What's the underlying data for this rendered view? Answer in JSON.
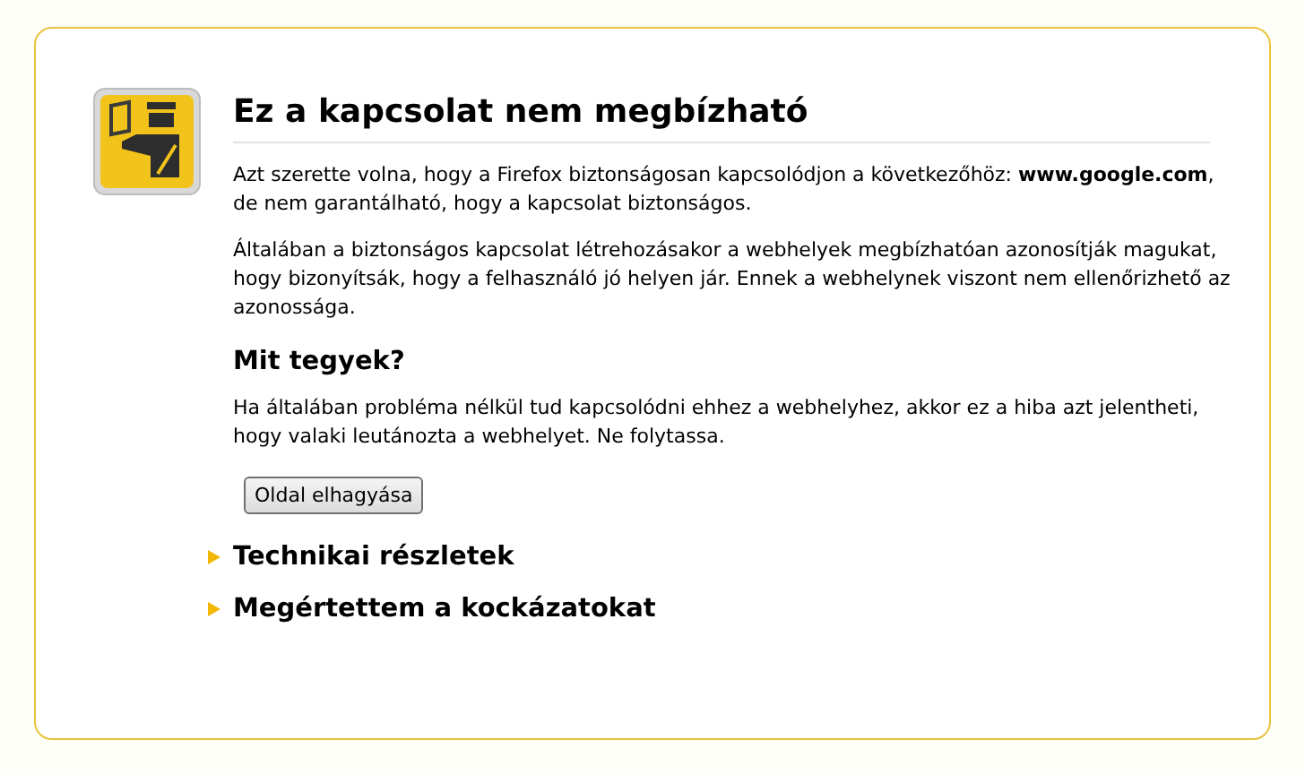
{
  "title": "Ez a kapcsolat nem megbízható",
  "intro": "Azt szerette volna, hogy a Firefox biztonságosan kapcsolódjon a következőhöz: **www.google.com**, de nem garantálható, hogy a kapcsolat biztonságos.",
  "explanation": "Általában a biztonságos kapcsolat létrehozásakor a webhelyek megbízhatóan azonosítják magukat, hogy bizonyítsák, hogy a felhasználó jó helyen jár. Ennek a webhelynek viszont nem ellenőrizhető az azonossága.",
  "what_to_do": {
    "heading": "Mit tegyek?",
    "text": "Ha általában probléma nélkül tud kapcsolódni ehhez a webhelyhez, akkor ez a hiba azt jelentheti, hogy valaki leutánozta a webhelyet. Ne folytassa.",
    "button": "Oldal elhagyása"
  },
  "sections": [
    {
      "label": "Technikai részletek",
      "expanded": false
    },
    {
      "label": "Megértettem a kockázatokat",
      "expanded": false
    }
  ]
}
